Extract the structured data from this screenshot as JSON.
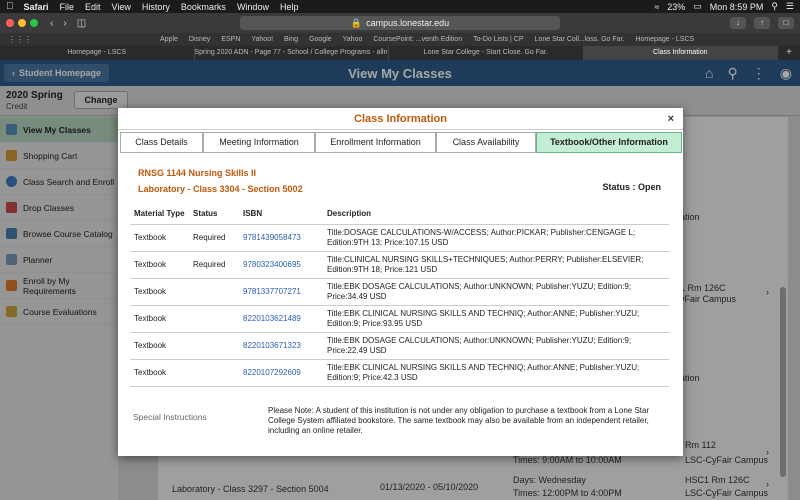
{
  "menubar": {
    "items": [
      "Safari",
      "File",
      "Edit",
      "View",
      "History",
      "Bookmarks",
      "Window",
      "Help"
    ],
    "battery": "23%",
    "clock": "Mon 8:59 PM"
  },
  "browser": {
    "url": "campus.lonestar.edu",
    "favorites": [
      "Apple",
      "Disney",
      "ESPN",
      "Yahoo!",
      "Bing",
      "Google",
      "Yahoo",
      "CoursePoint: ...venth Edition",
      "To-Do Lists | CP",
      "Lone Star Coll...loss. Go Far.",
      "Homepage - LSCS"
    ],
    "tabs": [
      {
        "label": "Homepage - LSCS",
        "active": false
      },
      {
        "label": "Spring 2020 ADN - Page 77 - School / College Programs - alln...",
        "active": false
      },
      {
        "label": "Lone Star College - Start Close. Go Far.",
        "active": false
      },
      {
        "label": "Class Information",
        "active": true
      }
    ]
  },
  "app": {
    "back_label": "Student Homepage",
    "title": "View My Classes",
    "term": "2020 Spring",
    "term_sub": "Credit",
    "change_label": "Change"
  },
  "sidebar": {
    "items": [
      {
        "label": "View My Classes",
        "active": true,
        "color": "#5a8fc2"
      },
      {
        "label": "Shopping Cart",
        "active": false,
        "color": "#d69a3a"
      },
      {
        "label": "Class Search and Enroll",
        "active": false,
        "color": "#3a7fc2"
      },
      {
        "label": "Drop Classes",
        "active": false,
        "color": "#c94a4a"
      },
      {
        "label": "Browse Course Catalog",
        "active": false,
        "color": "#4a7fb0"
      },
      {
        "label": "Planner",
        "active": false,
        "color": "#7a9ab8"
      },
      {
        "label": "Enroll by My Requirements",
        "active": false,
        "color": "#e07a2a"
      },
      {
        "label": "Course Evaluations",
        "active": false,
        "color": "#c9a43a"
      }
    ]
  },
  "background": {
    "fragments": [
      "ation",
      "1 Rm 126C",
      "yFair Campus",
      "ation",
      "Rm 112",
      "Times: 9:00AM to 10:00AM",
      "LSC-CyFair Campus",
      "Laboratory - Class 3297 - Section 5004",
      "01/13/2020 - 05/10/2020",
      "Days: Wednesday",
      "Times: 12:00PM to 4:00PM",
      "HSC1 Rm 126C",
      "LSC-CyFair Campus"
    ]
  },
  "modal": {
    "title": "Class Information",
    "close": "×",
    "tabs": [
      "Class Details",
      "Meeting Information",
      "Enrollment Information",
      "Class Availability",
      "Textbook/Other Information"
    ],
    "active_tab": 4,
    "course_line1": "RNSG 1144 Nursing Skills II",
    "course_line2": "Laboratory - Class 3304 - Section 5002",
    "status": "Status : Open",
    "table": {
      "headers": [
        "Material Type",
        "Status",
        "ISBN",
        "Description"
      ],
      "rows": [
        [
          "Textbook",
          "Required",
          "9781439058473",
          "Title:DOSAGE CALCULATIONS-W/ACCESS; Author:PICKAR; Publisher:CENGAGE L; Edition:9TH 13; Price:107.15 USD"
        ],
        [
          "Textbook",
          "Required",
          "9780323400695",
          "Title:CLINICAL NURSING SKILLS+TECHNIQUES; Author:PERRY; Publisher:ELSEVIER; Edition:9TH 18; Price:121 USD"
        ],
        [
          "Textbook",
          "",
          "9781337707271",
          "Title:EBK DOSAGE CALCULATIONS; Author:UNKNOWN; Publisher:YUZU; Edition:9; Price:34.49 USD"
        ],
        [
          "Textbook",
          "",
          "8220103621489",
          "Title:EBK CLINICAL NURSING SKILLS AND TECHNIQ; Author:ANNE; Publisher:YUZU; Edition:9; Price:93.95 USD"
        ],
        [
          "Textbook",
          "",
          "8220103671323",
          "Title:EBK DOSAGE CALCULATIONS; Author:UNKNOWN; Publisher:YUZU; Edition:9; Price:22.49 USD"
        ],
        [
          "Textbook",
          "",
          "8220107292609",
          "Title:EBK CLINICAL NURSING SKILLS AND TECHNIQ; Author:ANNE; Publisher:YUZU; Edition:9; Price:42.3 USD"
        ]
      ]
    },
    "special_label": "Special Instructions",
    "special_text": "Please Note:  A student of this institution is not under any obligation to purchase a textbook from a Lone Star College System affiliated bookstore.  The same textbook may also be available from an independent retailer, including an online retailer."
  }
}
